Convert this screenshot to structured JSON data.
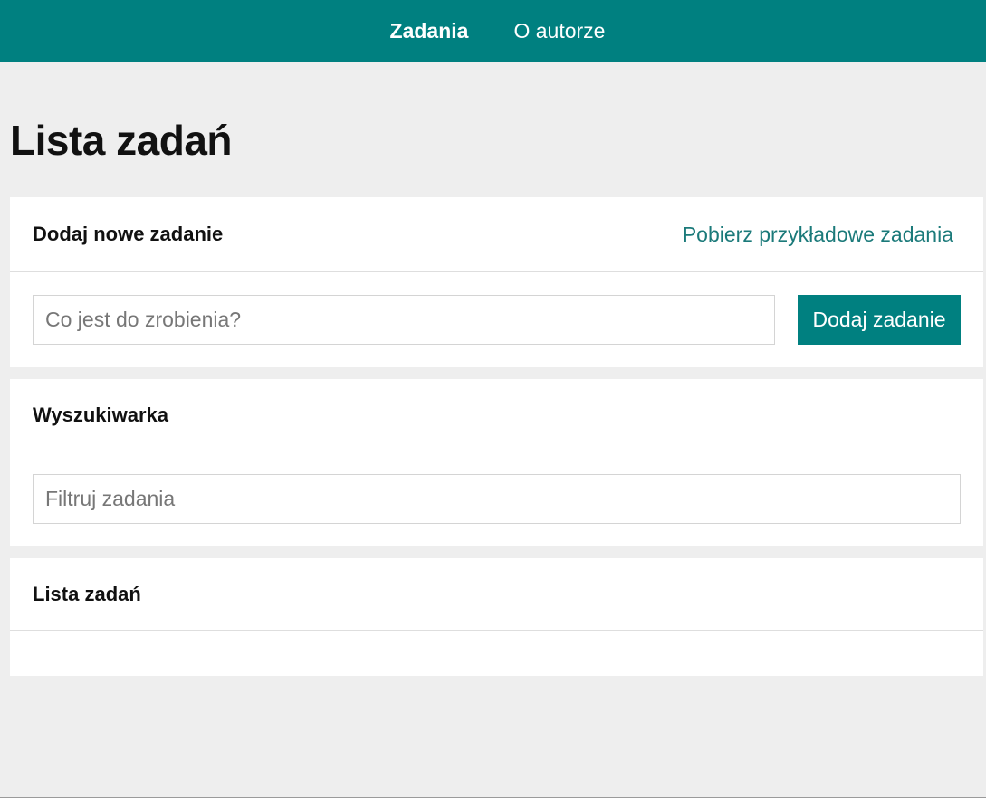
{
  "nav": {
    "items": [
      {
        "label": "Zadania"
      },
      {
        "label": "O autorze"
      }
    ]
  },
  "page": {
    "title": "Lista zadań"
  },
  "add_card": {
    "title": "Dodaj nowe zadanie",
    "sample_link": "Pobierz przykładowe zadania",
    "input_placeholder": "Co jest do zrobienia?",
    "input_value": "",
    "button_label": "Dodaj zadanie"
  },
  "search_card": {
    "title": "Wyszukiwarka",
    "input_placeholder": "Filtruj zadania",
    "input_value": ""
  },
  "list_card": {
    "title": "Lista zadań",
    "items": []
  },
  "colors": {
    "brand": "#008080",
    "link": "#1b7a7a",
    "background": "#eeeeee"
  }
}
